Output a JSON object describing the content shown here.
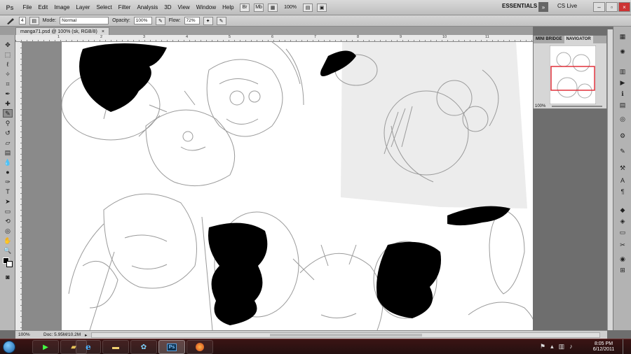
{
  "app": {
    "logo": "Ps",
    "menu": [
      "File",
      "Edit",
      "Image",
      "Layer",
      "Select",
      "Filter",
      "Analysis",
      "3D",
      "View",
      "Window",
      "Help"
    ],
    "zoom": "100%",
    "workspace": "ESSENTIALS",
    "workspace_arrow": "»",
    "cs_live": "CS Live"
  },
  "options": {
    "brush_size": "4",
    "mode_label": "Mode:",
    "mode_value": "Normal",
    "opacity_label": "Opacity:",
    "opacity_value": "100%",
    "flow_label": "Flow:",
    "flow_value": "72%"
  },
  "document": {
    "tab_title": "manga71.psd @ 100% (sk, RGB/8)",
    "tab_close": "×"
  },
  "rulers": {
    "top_ticks": [
      "1",
      "2",
      "3",
      "4",
      "5",
      "6",
      "7",
      "8",
      "9",
      "10",
      "11"
    ]
  },
  "navigator": {
    "tabs": [
      "MINI BRIDGE",
      "NAVIGATOR"
    ],
    "zoom": "100%",
    "view_box_color": "#e0303a"
  },
  "status": {
    "zoom": "100%",
    "doc": "Doc: 5.95M/10.2M"
  },
  "taskbar": {
    "apps": [
      "media-player",
      "explorer",
      "internet-explorer",
      "folder",
      "windows-live",
      "photoshop",
      "firefox"
    ],
    "time": "8:05 PM",
    "date": "6/12/2011"
  },
  "colors": {
    "redacted": "#000000",
    "sketch": "#7a7a7a",
    "taskbar": "#2e1212"
  }
}
